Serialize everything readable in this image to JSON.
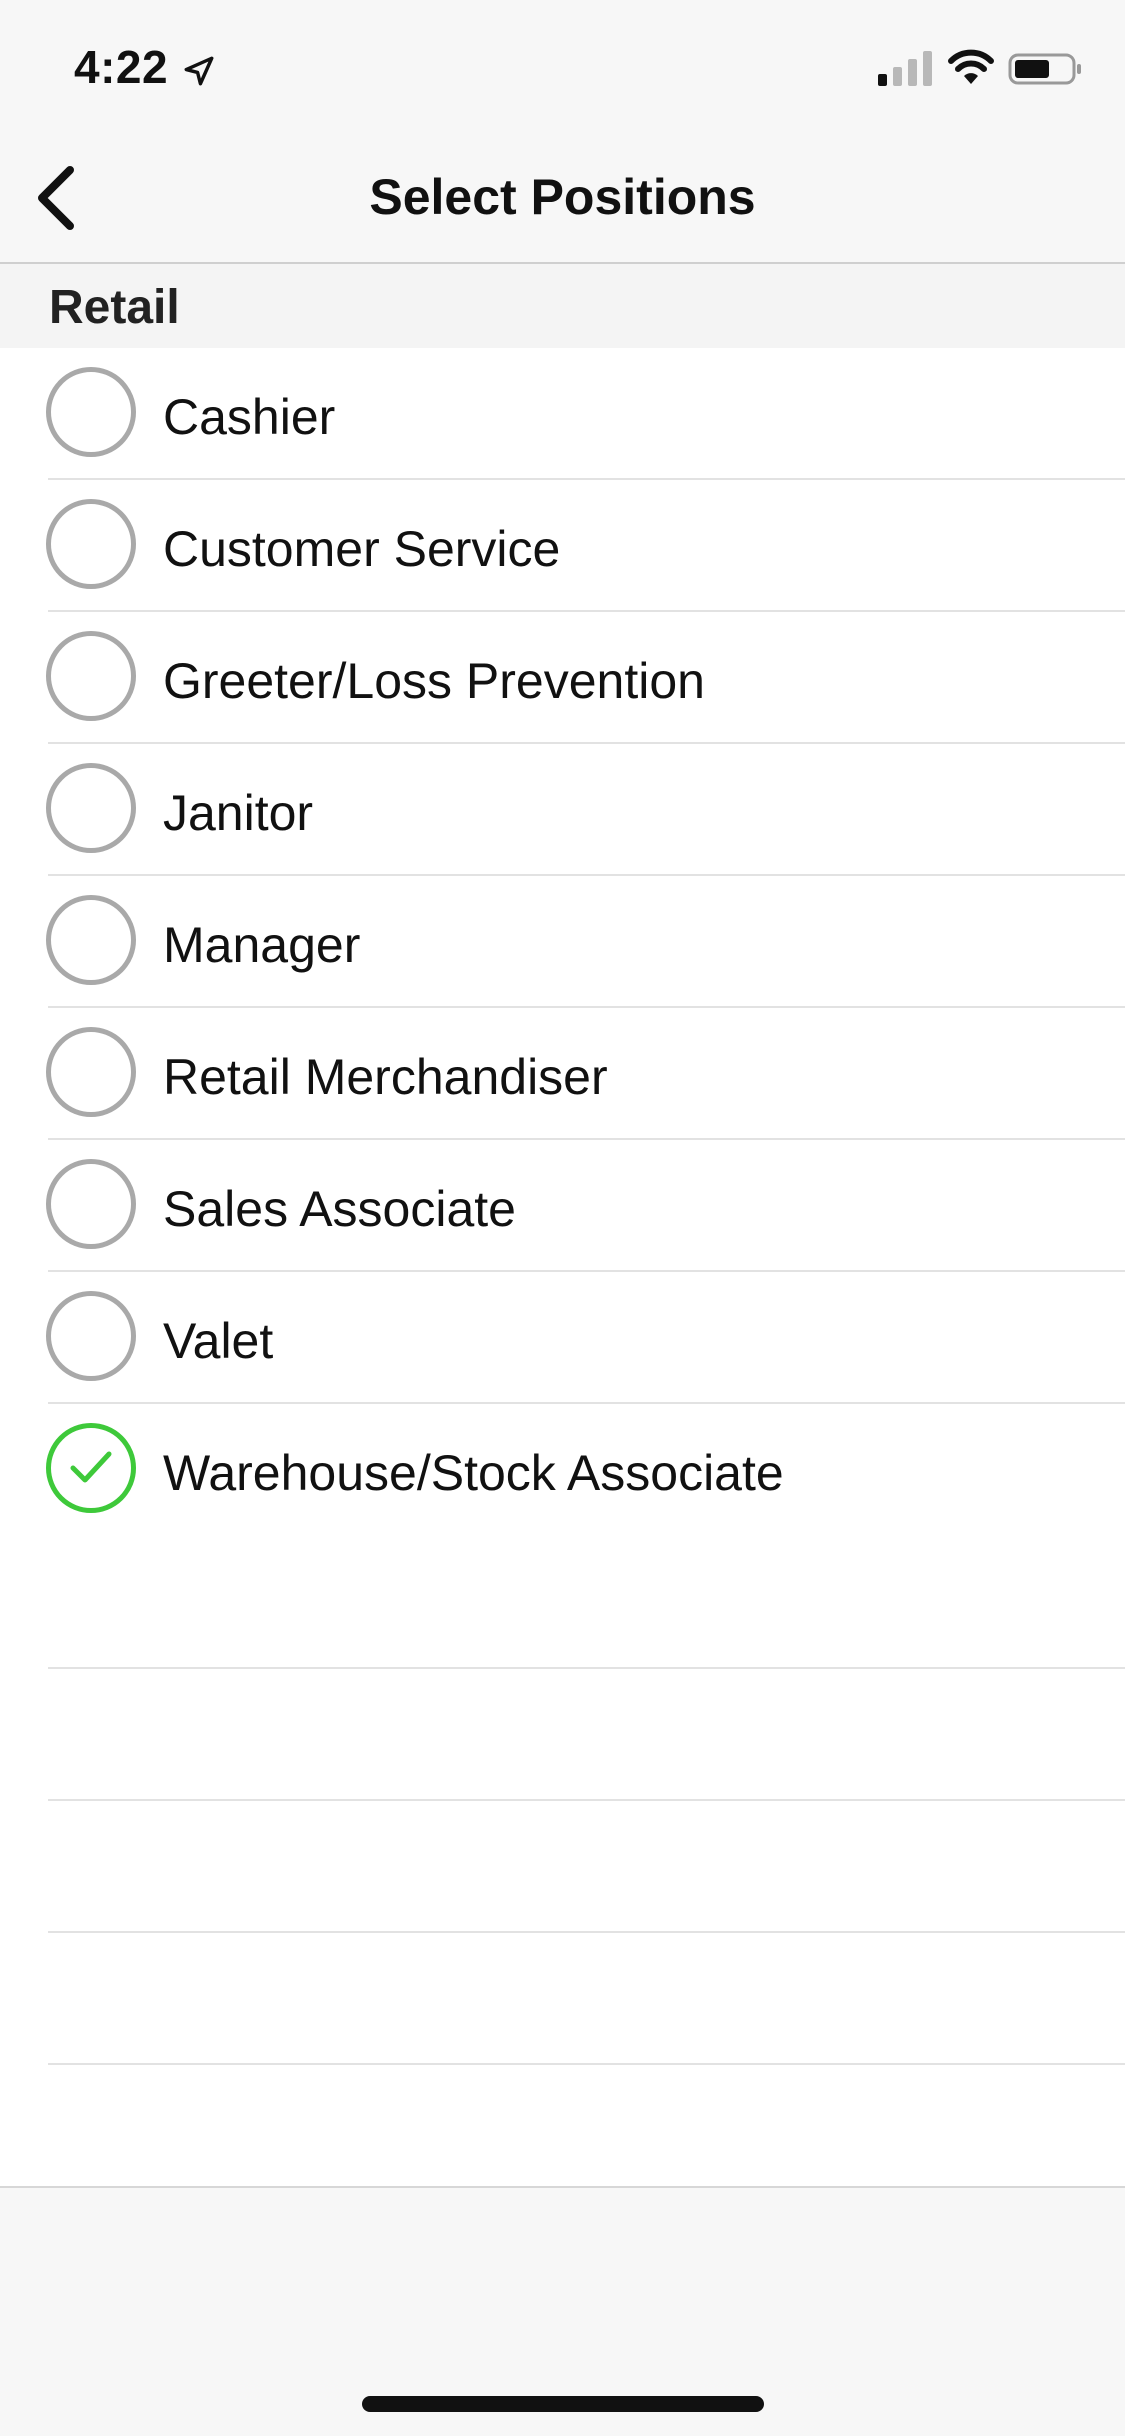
{
  "status_bar": {
    "time": "4:22",
    "icons": [
      "location-arrow-icon",
      "cellular-signal-icon",
      "wifi-icon",
      "battery-icon"
    ]
  },
  "nav": {
    "back_icon": "chevron-left-icon",
    "title": "Select Positions"
  },
  "section": {
    "title": "Retail"
  },
  "positions": [
    {
      "label": "Cashier",
      "selected": false
    },
    {
      "label": "Customer Service",
      "selected": false
    },
    {
      "label": "Greeter/Loss Prevention",
      "selected": false
    },
    {
      "label": "Janitor",
      "selected": false
    },
    {
      "label": "Manager",
      "selected": false
    },
    {
      "label": "Retail Merchandiser",
      "selected": false
    },
    {
      "label": "Sales Associate",
      "selected": false
    },
    {
      "label": "Valet",
      "selected": false
    },
    {
      "label": "Warehouse/Stock Associate",
      "selected": true
    }
  ],
  "colors": {
    "selected": "#3ec93a",
    "unselected": "#a9a9a9",
    "text": "#111111",
    "background": "#f7f7f7"
  }
}
